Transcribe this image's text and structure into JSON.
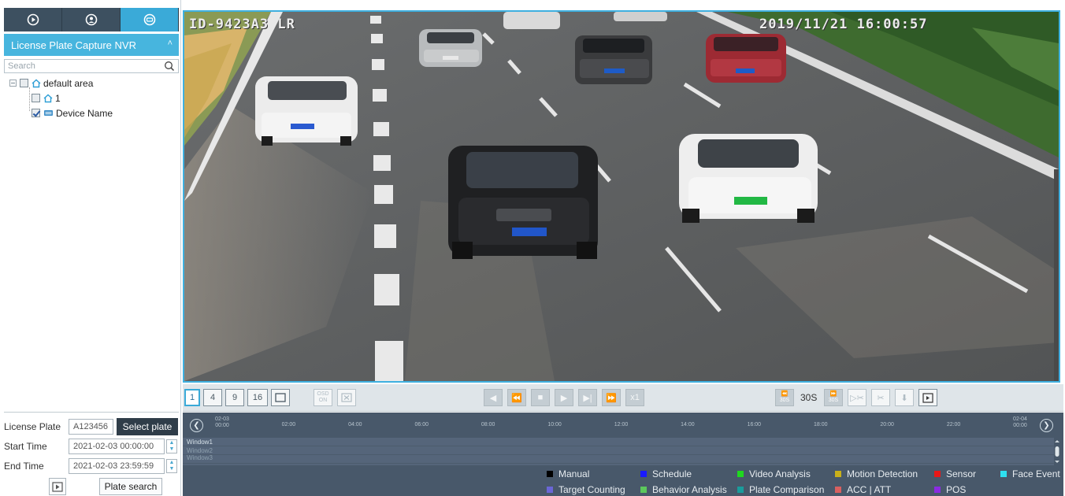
{
  "sidebar": {
    "tabs": [
      {
        "icon": "playback-icon",
        "active": false
      },
      {
        "icon": "face-playback-icon",
        "active": false
      },
      {
        "icon": "plate-playback-icon",
        "active": true
      }
    ],
    "panel_title": "License Plate Capture NVR",
    "search_placeholder": "Search",
    "tree": {
      "root": "default area",
      "child": "1",
      "device": "Device Name"
    },
    "license_plate_label": "License Plate",
    "license_plate_value": "A123456",
    "select_plate_label": "Select plate",
    "start_time_label": "Start Time",
    "start_time_value": "2021-02-03 00:00:00",
    "end_time_label": "End Time",
    "end_time_value": "2021-02-03 23:59:59",
    "plate_search_label": "Plate search"
  },
  "video": {
    "osd_left": "ID-9423A3 LR",
    "osd_right": "2019/11/21 16:00:57"
  },
  "toolbar": {
    "layouts": [
      "1",
      "4",
      "9",
      "16"
    ],
    "osd_label_top": "OSD",
    "osd_label_bottom": "ON",
    "speed": "x1",
    "skip_back": "30S",
    "interval": "30S",
    "skip_fwd": "30S"
  },
  "timeline": {
    "start_date": "02-03",
    "end_date": "02-04",
    "ticks": [
      "00:00",
      "02:00",
      "04:00",
      "06:00",
      "08:00",
      "10:00",
      "12:00",
      "14:00",
      "16:00",
      "18:00",
      "20:00",
      "22:00",
      "00:00"
    ],
    "windows": [
      "Window1",
      "Window2",
      "Window3"
    ]
  },
  "legend": [
    {
      "label": "Manual",
      "color": "#000000"
    },
    {
      "label": "Schedule",
      "color": "#1a1aff"
    },
    {
      "label": "Video Analysis",
      "color": "#1fd81f"
    },
    {
      "label": "Motion Detection",
      "color": "#c9b01a"
    },
    {
      "label": "Sensor",
      "color": "#e81818"
    },
    {
      "label": "Face Event",
      "color": "#2ee0f0"
    },
    {
      "label": "Target Counting",
      "color": "#6a66d6"
    },
    {
      "label": "Behavior Analysis",
      "color": "#5cc85c"
    },
    {
      "label": "Plate Comparison",
      "color": "#1a9c9c"
    },
    {
      "label": "ACC | ATT",
      "color": "#d86060"
    },
    {
      "label": "POS",
      "color": "#8a2be2"
    }
  ]
}
